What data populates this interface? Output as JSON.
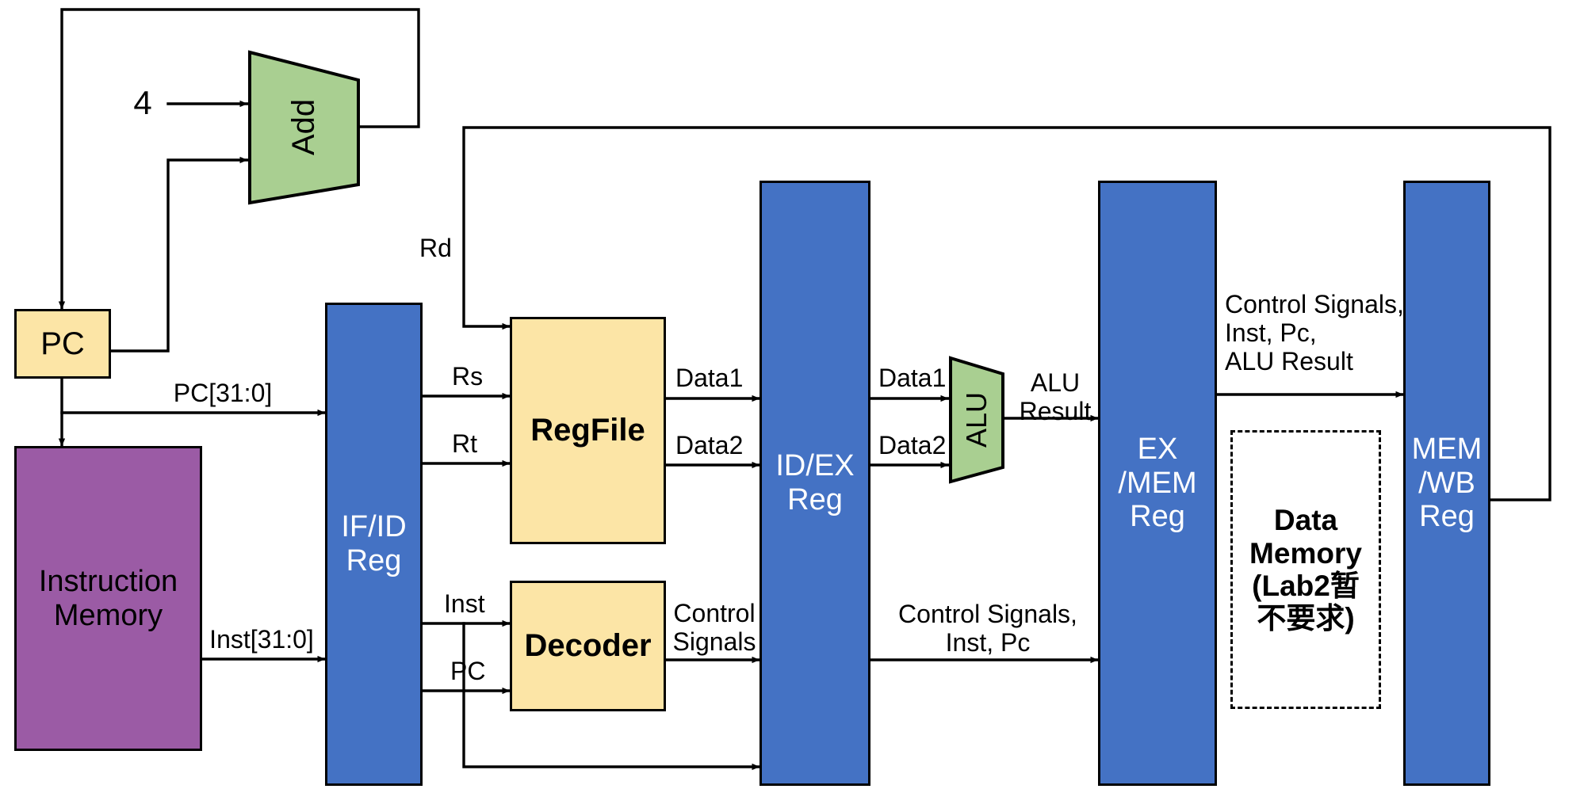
{
  "diagram": {
    "title": "MIPS 5-Stage Pipelined CPU Datapath",
    "colors": {
      "yellow": "#fce5a6",
      "purple": "#9b5ba5",
      "blue": "#4472c4",
      "green": "#a9cf91",
      "wire": "#000000",
      "background": "#ffffff"
    }
  },
  "blocks": {
    "pc": "PC",
    "instruction_memory": "Instruction\nMemory",
    "if_id_reg": "IF/ID\nReg",
    "regfile": "RegFile",
    "decoder": "Decoder",
    "id_ex_reg": "ID/EX\nReg",
    "ex_mem_reg": "EX\n/MEM\nReg",
    "data_memory": "Data\nMemory\n(Lab2暂\n不要求)",
    "mem_wb_reg": "MEM\n/WB\nReg",
    "add_unit": "Add",
    "alu_unit": "ALU"
  },
  "labels": {
    "const_four": "4",
    "pc_bus": "PC[31:0]",
    "inst_bus": "Inst[31:0]",
    "rd": "Rd",
    "rs": "Rs",
    "rt": "Rt",
    "data1_regfile_out": "Data1",
    "data2_regfile_out": "Data2",
    "data1_idex_out": "Data1",
    "data2_idex_out": "Data2",
    "alu_result": "ALU\nResult",
    "inst_to_decoder": "Inst",
    "pc_to_decoder": "PC",
    "control_signals_decoder_out": "Control\nSignals",
    "control_signals_idex_out": "Control Signals,\nInst, Pc",
    "control_signals_exmem_out": "Control Signals,\nInst, Pc,\nALU Result"
  }
}
